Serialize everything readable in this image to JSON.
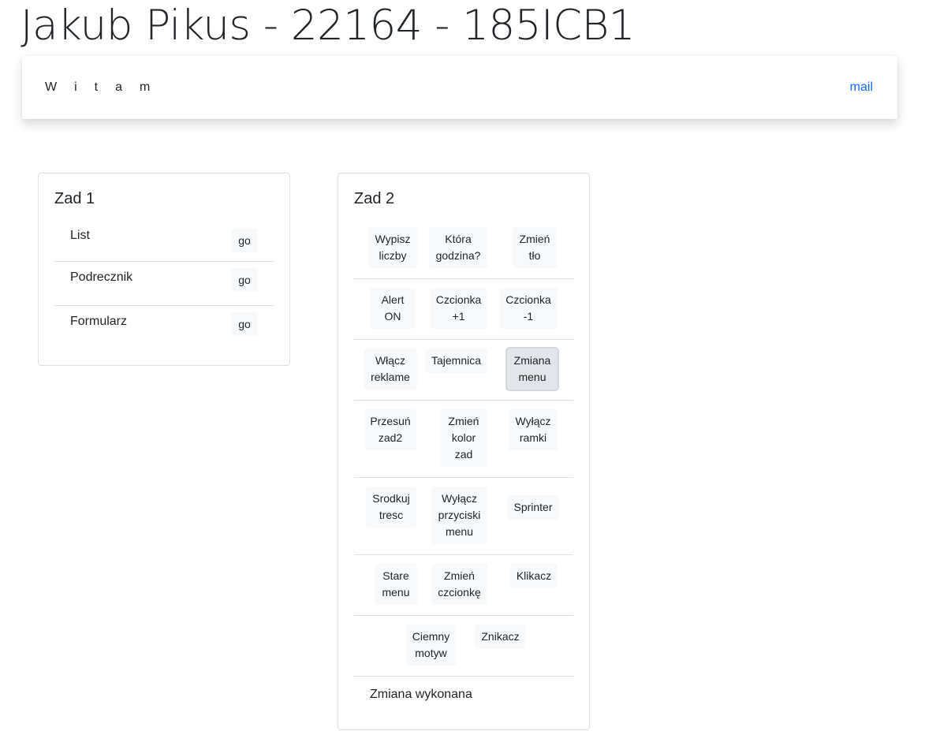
{
  "page": {
    "title": "Jakub Pikus - 22164 - 185ICB1"
  },
  "navbar": {
    "brand": "Witam",
    "link": "mail"
  },
  "zad1": {
    "title": "Zad 1",
    "items": [
      {
        "label": "List",
        "button": "go"
      },
      {
        "label": "Podrecznik",
        "button": "go"
      },
      {
        "label": "Formularz",
        "button": "go"
      }
    ]
  },
  "zad2": {
    "title": "Zad 2",
    "buttons": [
      "Wypisz\nliczby",
      "Która\ngodzina?",
      "Zmień\ntło",
      "Alert\nON",
      "Czcionka\n+1",
      "Czcionka\n-1",
      "Włącz\nreklame",
      "Tajemnica",
      "Zmiana\nmenu",
      "Przesuń\nzad2",
      "Zmień\nkolor\nzad",
      "Wyłącz\nramki",
      "Srodkuj\ntresc",
      "Wyłącz\nprzyciski\nmenu",
      "Sprinter",
      "Stare\nmenu",
      "Zmień\nczcionkę",
      "Klikacz",
      "Ciemny\nmotyw",
      "Znikacz"
    ],
    "active_button": "Zmiana\nmenu",
    "status": "Zmiana wykonana"
  }
}
